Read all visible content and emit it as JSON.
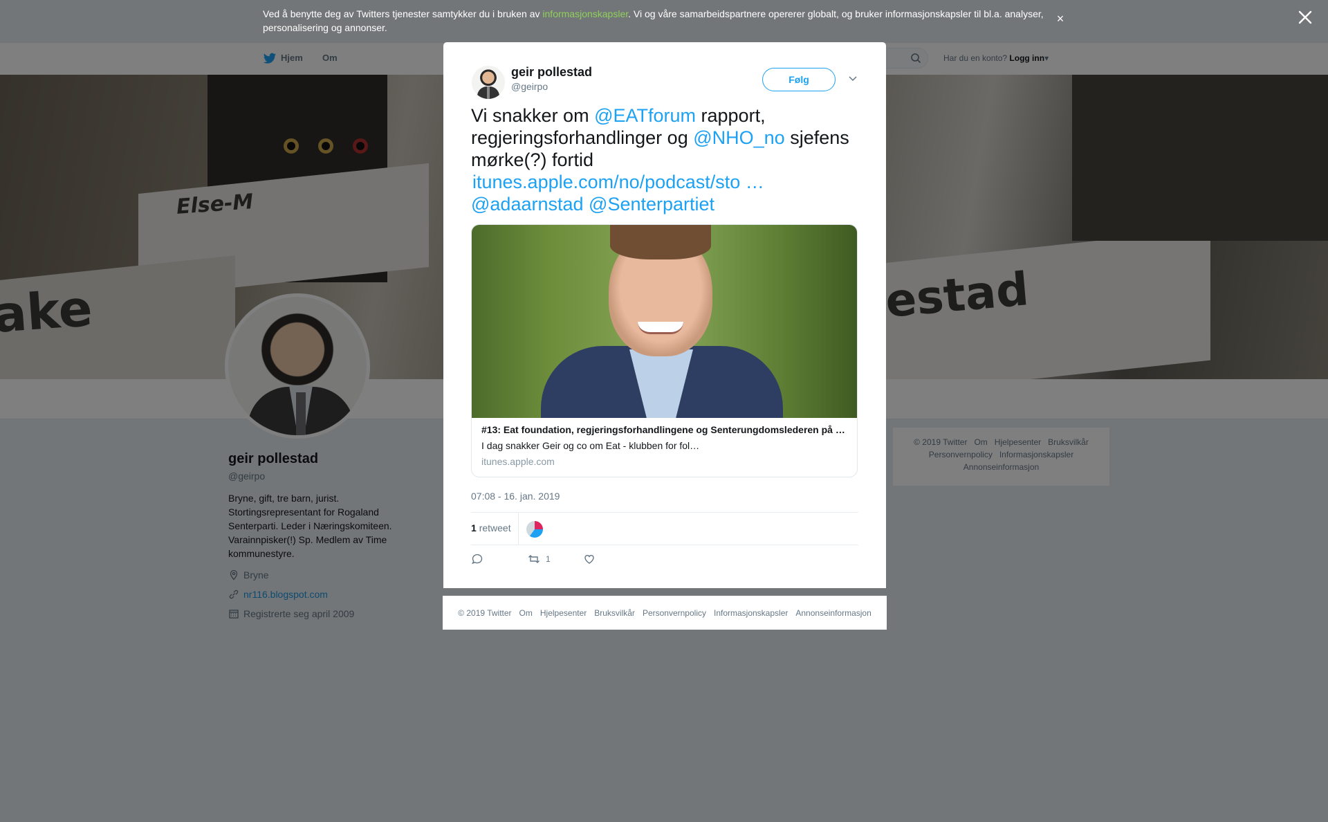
{
  "cookie_bar": {
    "text_before": "Ved å benytte deg av Twitters tjenester samtykker du i bruken av ",
    "link": "informasjonskapsler",
    "text_after": ". Vi og våre samarbeidspartnere opererer globalt, og bruker informasjonskapsler til bl.a. analyser, personalisering og annonser.",
    "close": "×"
  },
  "topnav": {
    "home": "Hjem",
    "about": "Om",
    "login_prompt": "Har du en konto?",
    "login": "Logg inn"
  },
  "banner": {
    "plate_left": "Else-M",
    "plate_left2": "ake",
    "plate_right": "estad"
  },
  "profile": {
    "name": "geir pollestad",
    "handle": "@geirpo",
    "bio": "Bryne, gift, tre barn, jurist. Stortingsrepresentant for Rogaland Senterparti. Leder i Næringskomiteen. Varainnpisker(!) Sp. Medlem av Time kommunestyre.",
    "location": "Bryne",
    "website": "nr116.blogspot.com",
    "joined": "Registrerte seg april 2009"
  },
  "side_footer": {
    "links": [
      "© 2019 Twitter",
      "Om",
      "Hjelpesenter",
      "Bruksvilkår",
      "Personvernpolicy",
      "Informasjonskapsler",
      "Annonseinformasjon"
    ]
  },
  "tweet": {
    "name": "geir pollestad",
    "handle": "@geirpo",
    "follow": "Følg",
    "text": {
      "p1": "Vi snakker om ",
      "m1": "@EATforum",
      "p2": " rapport, regjeringsforhandlinger og ",
      "m2": "@NHO_no",
      "p3": " sjefens mørke(?) fortid",
      "url": "itunes.apple.com/no/podcast/sto …",
      "m3": "@adaarnstad",
      "m4": "@Senterpartiet"
    },
    "card": {
      "title": "#13: Eat foundation, regjeringsforhandlingene og Senterungdomslederen på …",
      "description": "I dag snakker Geir og co om Eat - klubben for fol…",
      "domain": "itunes.apple.com"
    },
    "timestamp": "07:08 - 16. jan. 2019",
    "retweet_count": "1",
    "retweet_label": "retweet",
    "actions": {
      "reply_count": "",
      "retweet_count": "1",
      "like_count": ""
    }
  },
  "modal_footer": {
    "links": [
      "© 2019 Twitter",
      "Om",
      "Hjelpesenter",
      "Bruksvilkår",
      "Personvernpolicy",
      "Informasjonskapsler",
      "Annonseinformasjon"
    ]
  },
  "colors": {
    "link": "#1da1f2",
    "cookie_link": "#8fd05b",
    "overlay": "rgba(0,0,0,0.5)"
  }
}
